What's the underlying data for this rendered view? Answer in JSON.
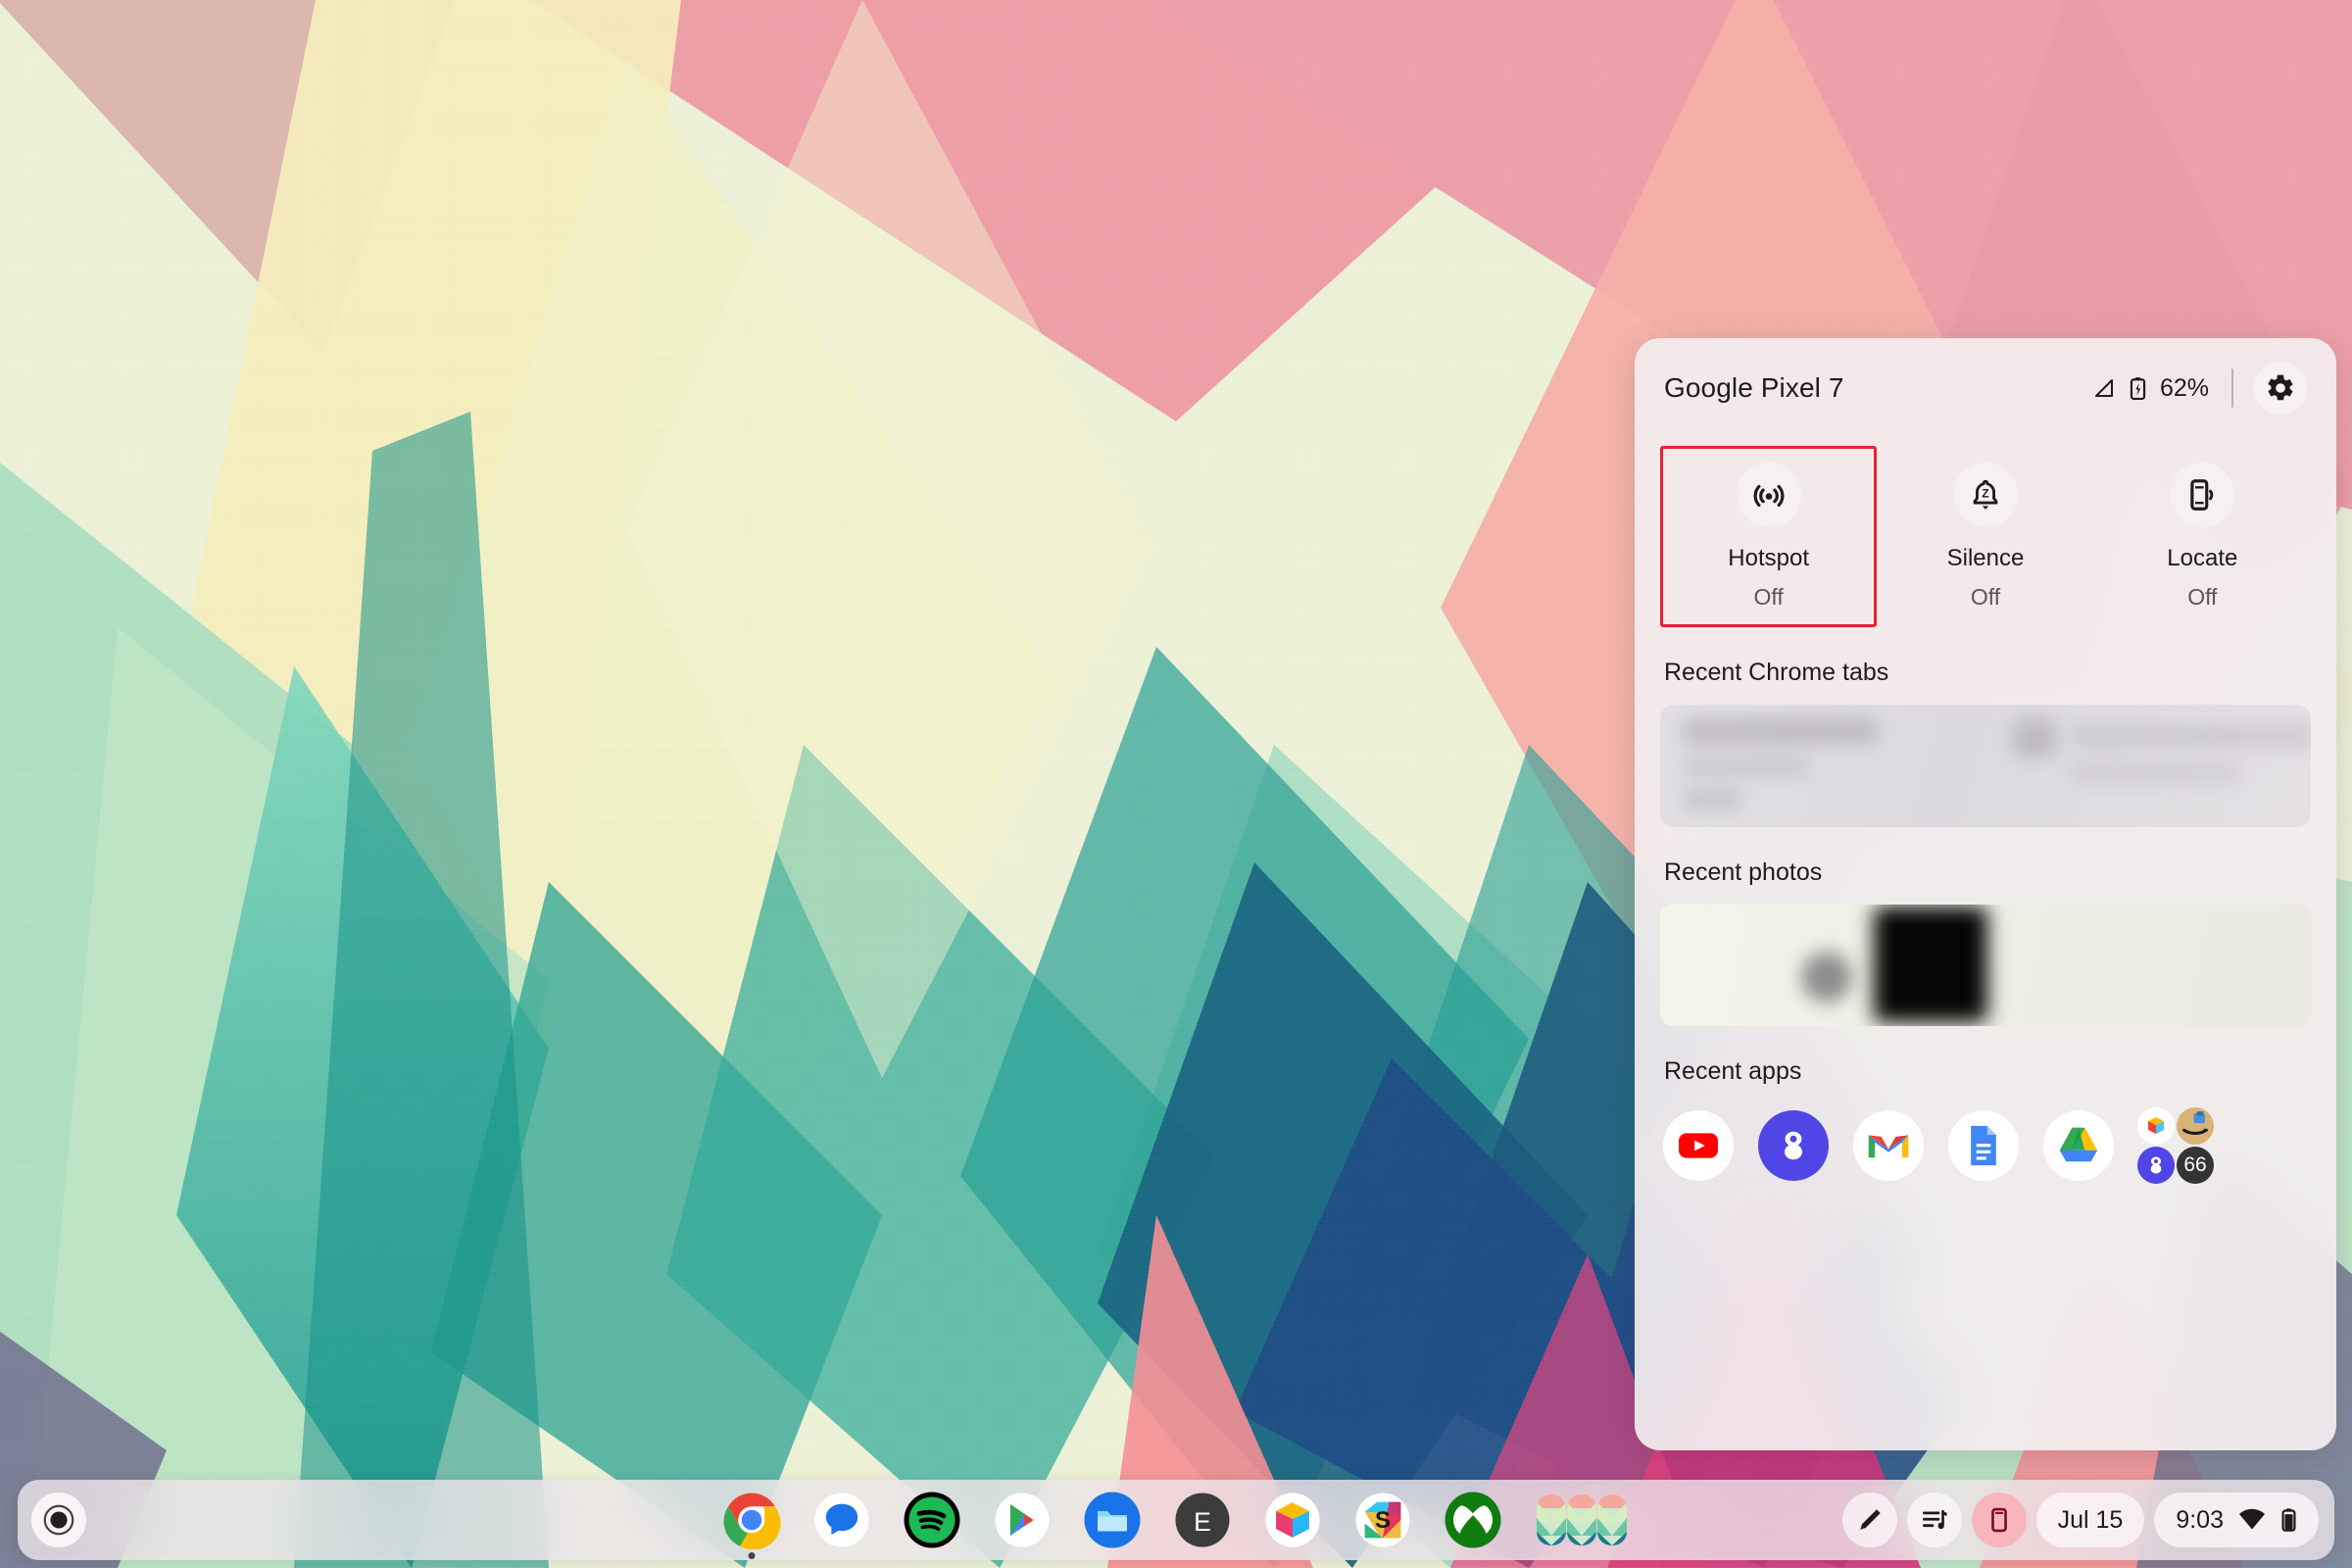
{
  "desktop": {
    "wallpaper_name": "geometric-triangles-wallpaper",
    "wallpaper_colors": [
      "#f2a3a8",
      "#f7b9ae",
      "#f6efc0",
      "#e9f0c2",
      "#b9e3c4",
      "#6ecdb0",
      "#2aa698",
      "#17897f",
      "#1d6e86",
      "#1d4f86",
      "#d93b7e",
      "#f2798f",
      "#8c8fa8",
      "#6b6f8c"
    ]
  },
  "phone_hub": {
    "title": "Google Pixel 7",
    "battery_percent": "62%",
    "signal_icon": "signal-bars-icon",
    "battery_icon": "battery-charging-icon",
    "settings_icon": "gear-icon",
    "quick_actions": [
      {
        "name": "hotspot",
        "label": "Hotspot",
        "state": "Off",
        "icon": "hotspot-icon",
        "selected": true
      },
      {
        "name": "silence",
        "label": "Silence",
        "state": "Off",
        "icon": "silence-phone-icon",
        "selected": false
      },
      {
        "name": "locate",
        "label": "Locate",
        "state": "Off",
        "icon": "locate-phone-icon",
        "selected": false
      }
    ],
    "sections": {
      "chrome_tabs_title": "Recent Chrome tabs",
      "photos_title": "Recent photos",
      "apps_title": "Recent apps"
    },
    "recent_apps": [
      {
        "name": "youtube",
        "icon": "youtube-icon"
      },
      {
        "name": "messages",
        "icon": "messages-icon"
      },
      {
        "name": "gmail",
        "icon": "gmail-icon"
      },
      {
        "name": "docs",
        "icon": "google-docs-icon"
      },
      {
        "name": "drive",
        "icon": "google-drive-icon"
      }
    ],
    "apps_overflow": {
      "icons": [
        "cube-app-icon",
        "amazon-icon",
        "messages-icon"
      ],
      "count_label": "66"
    },
    "selection_color": "#e8212e"
  },
  "shelf": {
    "launcher_icon": "launcher-icon",
    "apps": [
      {
        "name": "chrome",
        "icon": "chrome-icon",
        "running": true
      },
      {
        "name": "messages",
        "icon": "messages-icon",
        "running": false
      },
      {
        "name": "spotify",
        "icon": "spotify-icon",
        "running": false
      },
      {
        "name": "play-store",
        "icon": "play-store-icon",
        "running": false
      },
      {
        "name": "files",
        "icon": "files-icon",
        "running": false
      },
      {
        "name": "e-app",
        "icon": "e-app-icon",
        "running": false
      },
      {
        "name": "cube-app",
        "icon": "cube-app-icon",
        "running": false
      },
      {
        "name": "slack",
        "icon": "slack-icon",
        "running": false
      },
      {
        "name": "xbox",
        "icon": "xbox-icon",
        "running": false
      },
      {
        "name": "desks-overview",
        "icon": "desks-overview-icon",
        "running": false
      }
    ],
    "tray": {
      "stylus_icon": "stylus-pen-icon",
      "media_icon": "media-playlist-icon",
      "phone_hub_icon": "phone-hub-icon",
      "phone_hub_active": true,
      "date": "Jul 15",
      "time": "9:03",
      "network_icon": "wifi-icon",
      "battery_icon": "battery-icon"
    }
  }
}
